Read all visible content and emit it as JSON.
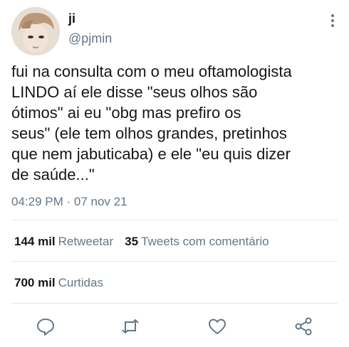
{
  "user": {
    "name": "ji",
    "handle": "@pjmin"
  },
  "tweet": {
    "text": "fui na consulta com o meu oftamologista\nLINDO aí ele disse \"seus olhos são\nótimos\" ai eu \"obg mas prefiro os\nseus\" (ele tem olhos grandes, pretinhos\nque nem jabuticaba) e ele \"eu quis dizer\nde saúde...\"",
    "timestamp": "04:29 PM · 07 nov 21"
  },
  "stats": {
    "retweets_count": "144 mil",
    "retweets_label": "Retweetar",
    "quotes_count": "35",
    "quotes_label": "Tweets com comentário",
    "likes_count": "700 mil",
    "likes_label": "Curtidas"
  },
  "actions": [
    {
      "icon": "reply-icon"
    },
    {
      "icon": "retweet-icon"
    },
    {
      "icon": "like-icon"
    },
    {
      "icon": "share-icon"
    }
  ],
  "colors": {
    "text": "#14171a",
    "secondary": "#657786",
    "divider": "#e1e8ed"
  }
}
